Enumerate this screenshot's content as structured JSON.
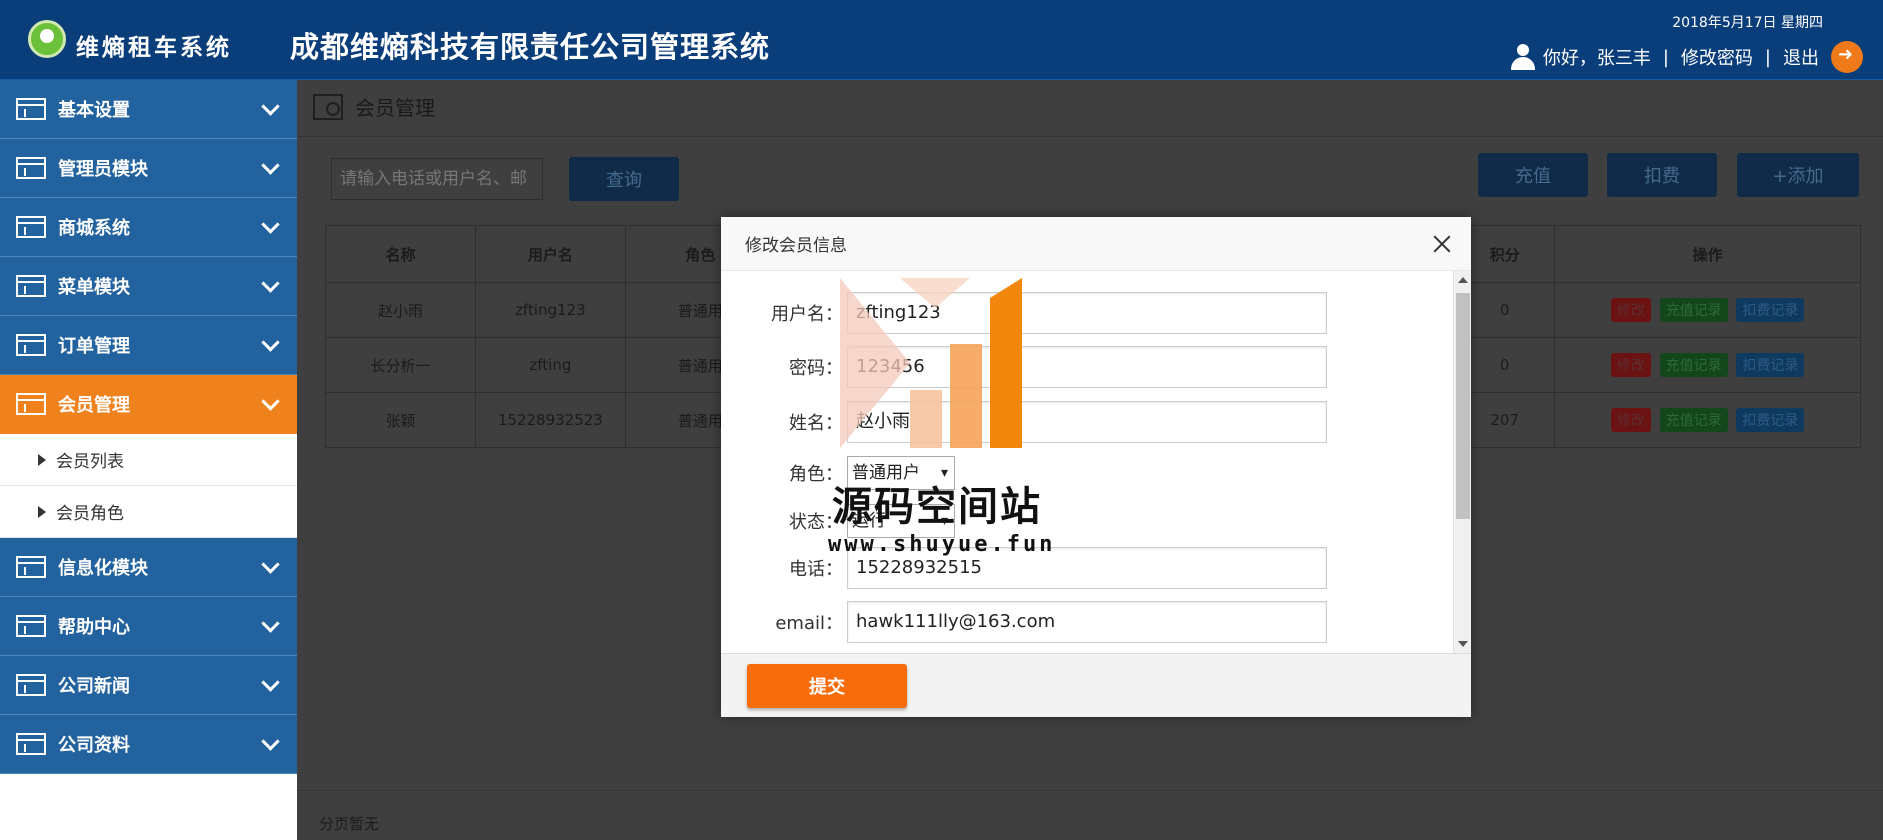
{
  "header": {
    "brand": "维熵租车系统",
    "title": "成都维熵科技有限责任公司管理系统",
    "date": "2018年5月17日 星期四",
    "greeting": "你好，张三丰",
    "separator": "|",
    "change_password": "修改密码",
    "logout": "退出"
  },
  "sidebar": {
    "items": [
      {
        "label": "基本设置",
        "icon": "window-icon"
      },
      {
        "label": "管理员模块",
        "icon": "window-icon"
      },
      {
        "label": "商城系统",
        "icon": "window-icon"
      },
      {
        "label": "菜单模块",
        "icon": "window-icon"
      },
      {
        "label": "订单管理",
        "icon": "window-icon"
      },
      {
        "label": "会员管理",
        "icon": "window-icon",
        "active": true
      },
      {
        "label": "信息化模块",
        "icon": "window-icon"
      },
      {
        "label": "帮助中心",
        "icon": "window-icon"
      },
      {
        "label": "公司新闻",
        "icon": "window-icon"
      },
      {
        "label": "公司资料",
        "icon": "window-icon"
      }
    ],
    "sub_items": [
      "会员列表",
      "会员角色"
    ]
  },
  "main": {
    "breadcrumb": "会员管理",
    "search_placeholder": "请输入电话或用户名、邮",
    "query_button": "查询",
    "recharge_button": "充值",
    "deduct_button": "扣费",
    "add_button": "+添加",
    "table": {
      "headers": [
        "名称",
        "用户名",
        "角色",
        "积分",
        "操作"
      ],
      "rows": [
        {
          "name": "赵小雨",
          "username": "zfting123",
          "role": "普通用",
          "points": "0"
        },
        {
          "name": "长分析一",
          "username": "zfting",
          "role": "普通用",
          "points": "0"
        },
        {
          "name": "张颖",
          "username": "15228932523",
          "role": "普通用",
          "points": "207"
        }
      ],
      "actions": [
        "修改",
        "充值记录",
        "扣费记录"
      ]
    },
    "pager": "分页暂无"
  },
  "modal": {
    "title": "修改会员信息",
    "fields": {
      "username_label": "用户名：",
      "username_value": "zfting123",
      "password_label": "密码：",
      "password_value": "123456",
      "realname_label": "姓名：",
      "realname_value": "赵小雨",
      "role_label": "角色：",
      "role_value": "普通用户",
      "status_label": "状态：",
      "status_value": "运行",
      "phone_label": "电话：",
      "phone_value": "15228932515",
      "email_label": "email：",
      "email_value": "hawk111lly@163.com"
    },
    "submit": "提交"
  },
  "watermark": {
    "text": "源码空间站",
    "url": "www.shuyue.fun"
  },
  "colors": {
    "header_bg": "#0a3e7a",
    "sidebar_bg": "#22629e",
    "active_bg": "#f0821e",
    "submit_bg": "#f76d0c"
  }
}
